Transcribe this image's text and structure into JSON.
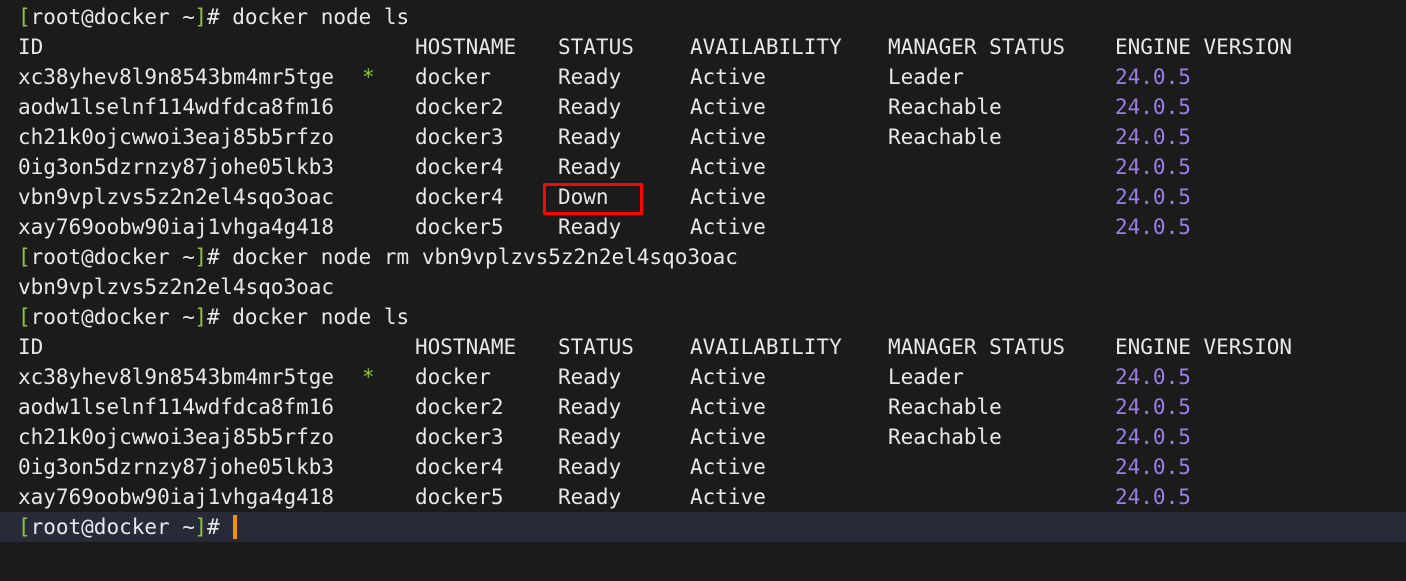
{
  "terminal": {
    "title": "root@docker terminal",
    "prompt": {
      "open_bracket": "[",
      "user_host": "root@docker ~",
      "close_bracket": "]",
      "hash": "#"
    },
    "colors": {
      "background": "#1b1b1b",
      "foreground": "#e8e8e8",
      "prompt_bracket": "#8ec63f",
      "engine_version": "#9b7ee8",
      "leader_star": "#8ec63f",
      "active_line_background": "#282a3a",
      "cursor": "#f0920a",
      "highlight_box": "#fb0505"
    },
    "columns": {
      "id": "ID",
      "hostname": "HOSTNAME",
      "status": "STATUS",
      "availability": "AVAILABILITY",
      "manager_status": "MANAGER STATUS",
      "engine_version": "ENGINE VERSION"
    },
    "commands": {
      "node_ls": "docker node ls",
      "node_rm": "docker node rm vbn9vplzvs5z2n2el4sqo3oac"
    },
    "rm_output": "vbn9vplzvs5z2n2el4sqo3oac",
    "table_one": [
      {
        "id": "xc38yhev8l9n8543bm4mr5tge",
        "leader_marker": "*",
        "hostname": "docker",
        "status": "Ready",
        "availability": "Active",
        "manager_status": "Leader",
        "engine_version": "24.0.5"
      },
      {
        "id": "aodw1lselnf114wdfdca8fm16",
        "leader_marker": "",
        "hostname": "docker2",
        "status": "Ready",
        "availability": "Active",
        "manager_status": "Reachable",
        "engine_version": "24.0.5"
      },
      {
        "id": "ch21k0ojcwwoi3eaj85b5rfzo",
        "leader_marker": "",
        "hostname": "docker3",
        "status": "Ready",
        "availability": "Active",
        "manager_status": "Reachable",
        "engine_version": "24.0.5"
      },
      {
        "id": "0ig3on5dzrnzy87johe05lkb3",
        "leader_marker": "",
        "hostname": "docker4",
        "status": "Ready",
        "availability": "Active",
        "manager_status": "",
        "engine_version": "24.0.5"
      },
      {
        "id": "vbn9vplzvs5z2n2el4sqo3oac",
        "leader_marker": "",
        "hostname": "docker4",
        "status": "Down",
        "availability": "Active",
        "manager_status": "",
        "engine_version": "24.0.5"
      },
      {
        "id": "xay769oobw90iaj1vhga4g418",
        "leader_marker": "",
        "hostname": "docker5",
        "status": "Ready",
        "availability": "Active",
        "manager_status": "",
        "engine_version": "24.0.5"
      }
    ],
    "table_two": [
      {
        "id": "xc38yhev8l9n8543bm4mr5tge",
        "leader_marker": "*",
        "hostname": "docker",
        "status": "Ready",
        "availability": "Active",
        "manager_status": "Leader",
        "engine_version": "24.0.5"
      },
      {
        "id": "aodw1lselnf114wdfdca8fm16",
        "leader_marker": "",
        "hostname": "docker2",
        "status": "Ready",
        "availability": "Active",
        "manager_status": "Reachable",
        "engine_version": "24.0.5"
      },
      {
        "id": "ch21k0ojcwwoi3eaj85b5rfzo",
        "leader_marker": "",
        "hostname": "docker3",
        "status": "Ready",
        "availability": "Active",
        "manager_status": "Reachable",
        "engine_version": "24.0.5"
      },
      {
        "id": "0ig3on5dzrnzy87johe05lkb3",
        "leader_marker": "",
        "hostname": "docker4",
        "status": "Ready",
        "availability": "Active",
        "manager_status": "",
        "engine_version": "24.0.5"
      },
      {
        "id": "xay769oobw90iaj1vhga4g418",
        "leader_marker": "",
        "hostname": "docker5",
        "status": "Ready",
        "availability": "Active",
        "manager_status": "",
        "engine_version": "24.0.5"
      }
    ]
  }
}
